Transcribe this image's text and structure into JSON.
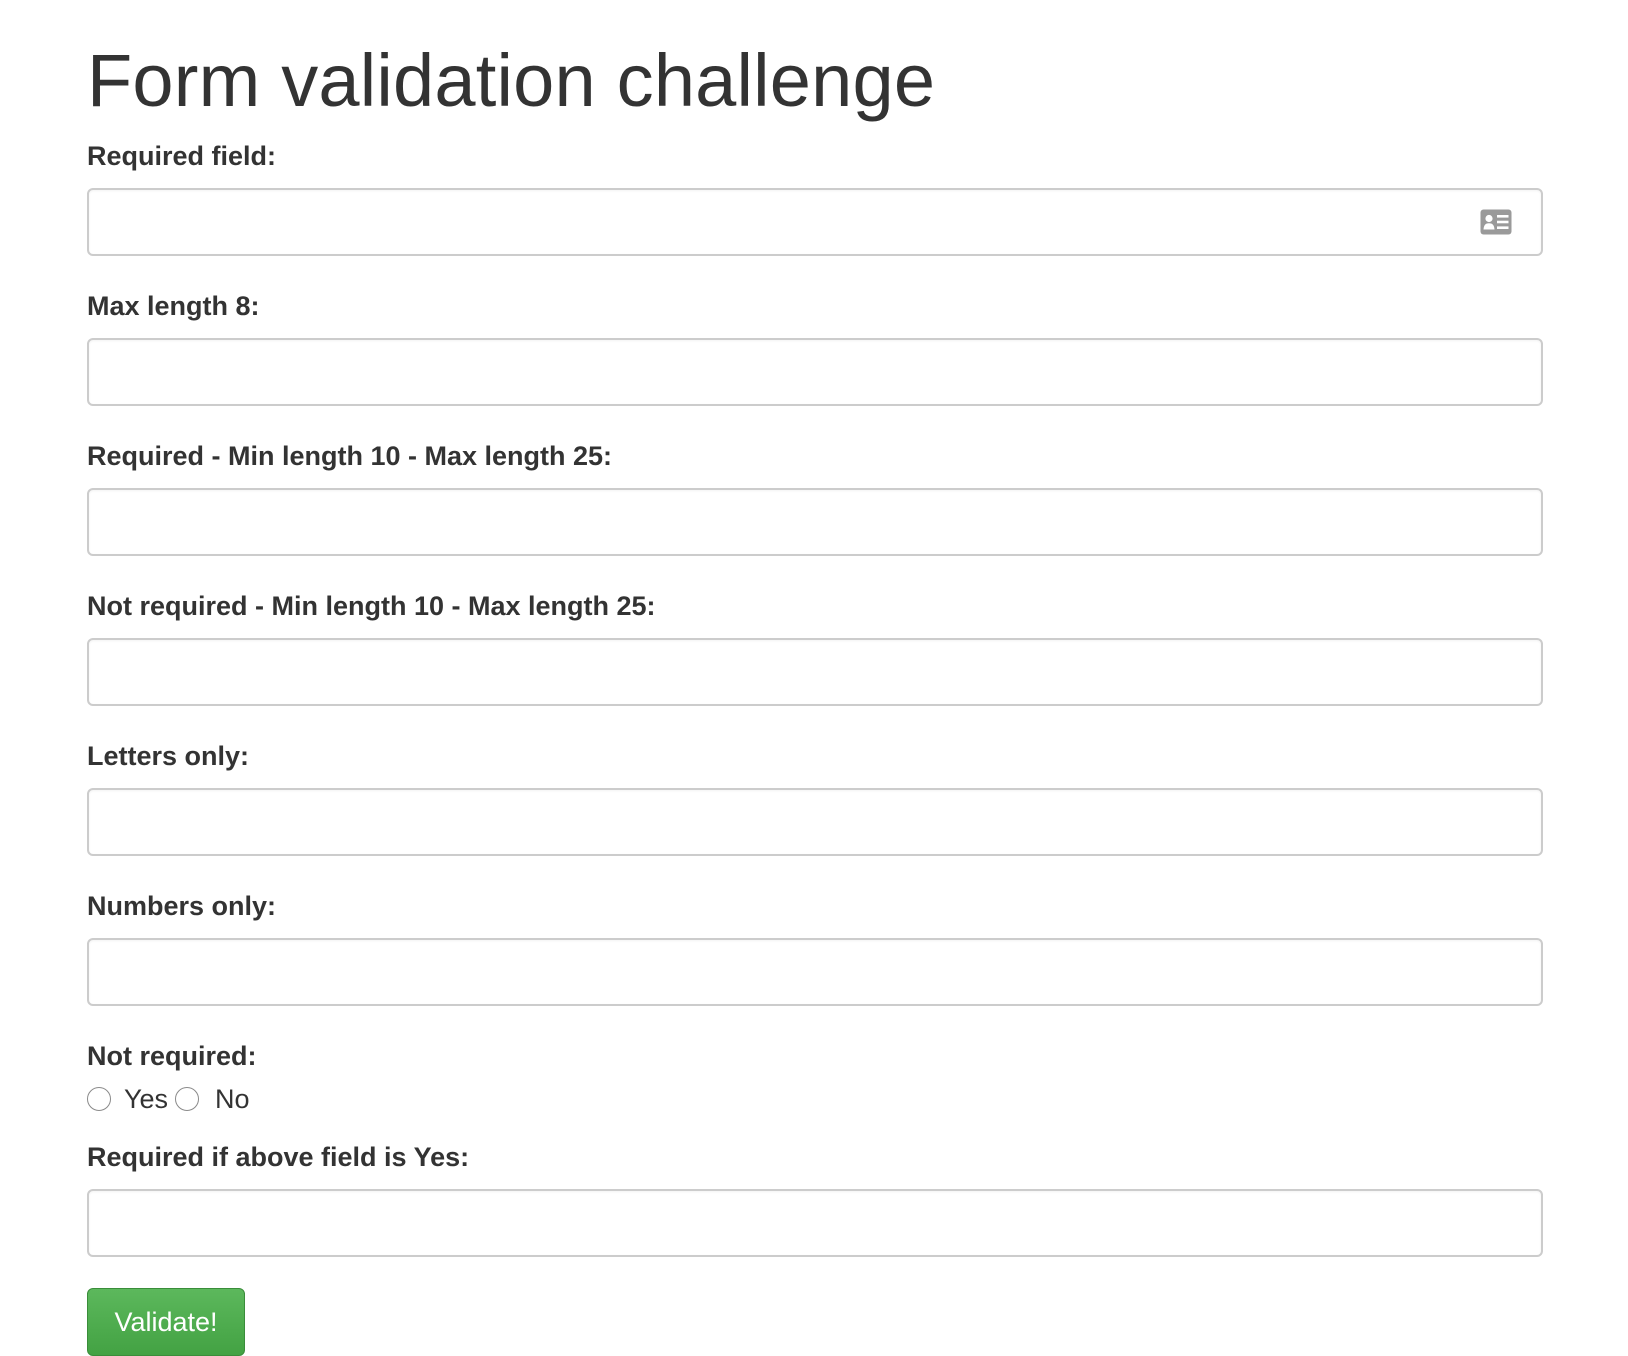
{
  "page": {
    "title": "Form validation challenge"
  },
  "fields": [
    {
      "label": "Required field:",
      "value": "",
      "placeholder": ""
    },
    {
      "label": "Max length 8:",
      "value": "",
      "placeholder": ""
    },
    {
      "label": "Required - Min length 10 - Max length 25:",
      "value": "",
      "placeholder": ""
    },
    {
      "label": "Not required - Min length 10 - Max length 25:",
      "value": "",
      "placeholder": ""
    },
    {
      "label": "Letters only:",
      "value": "",
      "placeholder": ""
    },
    {
      "label": "Numbers only:",
      "value": "",
      "placeholder": ""
    }
  ],
  "radio_group": {
    "label": "Not required:",
    "options": [
      {
        "label": "Yes",
        "selected": false
      },
      {
        "label": "No",
        "selected": false
      }
    ]
  },
  "conditional_field": {
    "label": "Required if above field is Yes:",
    "value": "",
    "placeholder": ""
  },
  "submit": {
    "label": "Validate!",
    "color": "#5cb85c"
  },
  "icons": {
    "autofill": "contact-card-icon"
  },
  "colors": {
    "text": "#333333",
    "input_border": "#cccccc",
    "button_bg": "#5cb85c",
    "button_text": "#ffffff"
  }
}
